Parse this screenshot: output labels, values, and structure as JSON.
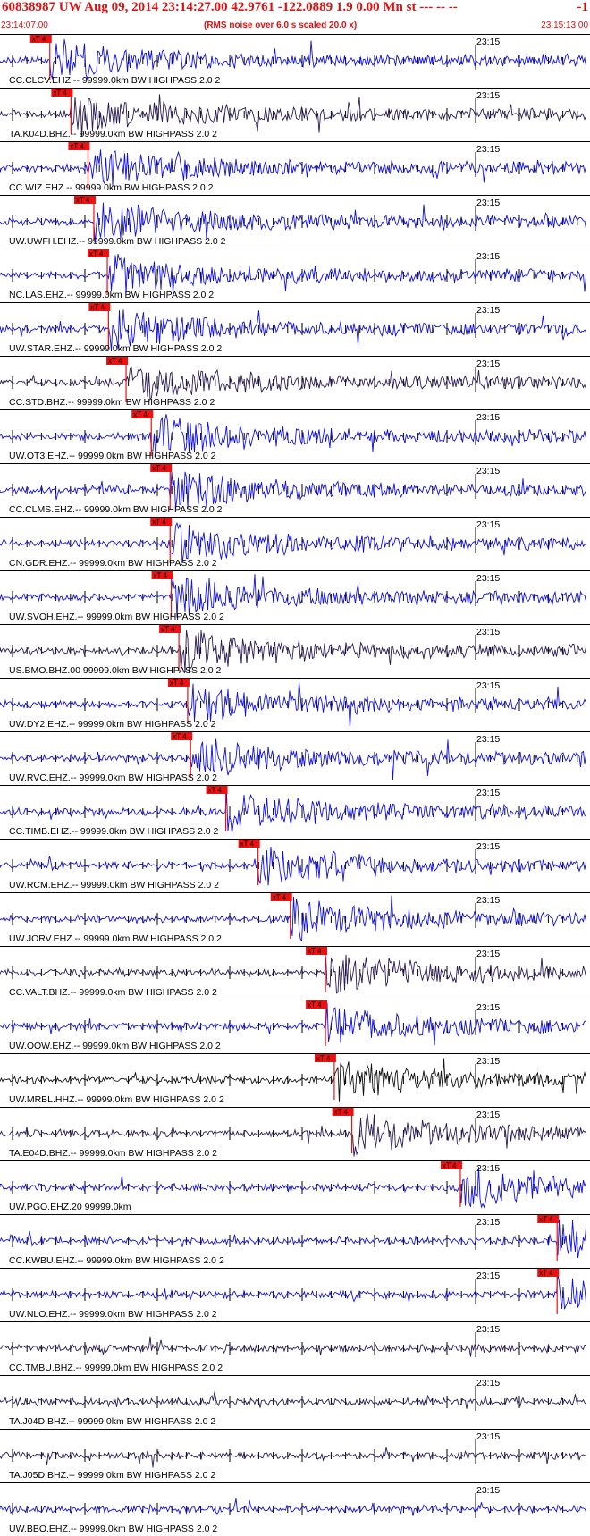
{
  "header": {
    "title": "60838987 UW Aug 09, 2014 23:14:27.00   42.9761 -122.0889  1.9 0.00 Mn st --- -- --",
    "end_mark": "-1",
    "start_time": "23:14:07.00",
    "rms_note": "(RMS noise over 6.0 s scaled 20.0 x)",
    "end_time": "23:15:13.00"
  },
  "tick_label": "23:15",
  "pick_label": "xT 4",
  "colors": {
    "header": "#dd1111",
    "blue": "#1010dd",
    "dark": "#2a1a55",
    "black": "#111111",
    "pick": "#ee1111",
    "grid": "#000000"
  },
  "traces": [
    {
      "label": "CC.CLCV.EHZ.-- 99999.0km BW  HIGHPASS  2.0  2",
      "color": "blue",
      "pick": 0.085
    },
    {
      "label": "TA.K04D.BHZ.-- 99999.0km BW  HIGHPASS  2.0  2",
      "color": "dark",
      "pick": 0.121
    },
    {
      "label": "CC.WIZ.EHZ.-- 99999.0km BW  HIGHPASS  2.0  2",
      "color": "blue",
      "pick": 0.15
    },
    {
      "label": "UW.UWFH.EHZ.-- 99999.0km BW  HIGHPASS  2.0  2",
      "color": "blue",
      "pick": 0.16
    },
    {
      "label": "NC.LAS.EHZ.-- 99999.0km BW  HIGHPASS  2.0  2",
      "color": "blue",
      "pick": 0.183
    },
    {
      "label": "UW.STAR.EHZ.-- 99999.0km BW  HIGHPASS  2.0  2",
      "color": "blue",
      "pick": 0.185
    },
    {
      "label": "CC.STD.BHZ.-- 99999.0km BW  HIGHPASS  2.0  2",
      "color": "dark",
      "pick": 0.215
    },
    {
      "label": "UW.OT3.EHZ.-- 99999.0km BW  HIGHPASS  2.0  2",
      "color": "blue",
      "pick": 0.258
    },
    {
      "label": "CC.CLMS.EHZ.-- 99999.0km BW  HIGHPASS  2.0  2",
      "color": "blue",
      "pick": 0.29
    },
    {
      "label": "CN.GDR.EHZ.-- 99999.0km BW  HIGHPASS  2.0  2",
      "color": "blue",
      "pick": 0.29
    },
    {
      "label": "UW.SVOH.EHZ.-- 99999.0km BW  HIGHPASS  2.0  2",
      "color": "blue",
      "pick": 0.292
    },
    {
      "label": "US.BMO.BHZ.00 99999.0km BW  HIGHPASS  2.0  2",
      "color": "dark",
      "pick": 0.305
    },
    {
      "label": "UW.DY2.EHZ.-- 99999.0km BW  HIGHPASS  2.0  2",
      "color": "blue",
      "pick": 0.32
    },
    {
      "label": "UW.RVC.EHZ.-- 99999.0km BW  HIGHPASS  2.0  2",
      "color": "blue",
      "pick": 0.325
    },
    {
      "label": "CC.TIMB.EHZ.-- 99999.0km BW  HIGHPASS  2.0  2",
      "color": "blue",
      "pick": 0.385
    },
    {
      "label": "UW.RCM.EHZ.-- 99999.0km BW  HIGHPASS  2.0  2",
      "color": "blue",
      "pick": 0.44
    },
    {
      "label": "UW.JORV.EHZ.-- 99999.0km BW  HIGHPASS  2.0  2",
      "color": "blue",
      "pick": 0.495
    },
    {
      "label": "CC.VALT.BHZ.-- 99999.0km BW  HIGHPASS  2.0  2",
      "color": "dark",
      "pick": 0.555
    },
    {
      "label": "UW.OOW.EHZ.-- 99999.0km BW  HIGHPASS  2.0  2",
      "color": "blue",
      "pick": 0.555
    },
    {
      "label": "UW.MRBL.HHZ.-- 99999.0km BW  HIGHPASS  2.0  2",
      "color": "black",
      "pick": 0.57
    },
    {
      "label": "TA.E04D.BHZ.-- 99999.0km BW  HIGHPASS  2.0  2",
      "color": "dark",
      "pick": 0.6
    },
    {
      "label": "UW.PGO.EHZ.20 99999.0km",
      "color": "blue",
      "pick": 0.785
    },
    {
      "label": "CC.KWBU.EHZ.-- 99999.0km BW  HIGHPASS  2.0  2",
      "color": "blue",
      "pick": 0.95
    },
    {
      "label": "UW.NLO.EHZ.-- 99999.0km BW  HIGHPASS  2.0  2",
      "color": "blue",
      "pick": 0.95
    },
    {
      "label": "CC.TMBU.BHZ.-- 99999.0km BW  HIGHPASS  2.0  2",
      "color": "dark",
      "pick": null
    },
    {
      "label": "TA.J04D.BHZ.-- 99999.0km BW  HIGHPASS  2.0  2",
      "color": "dark",
      "pick": null
    },
    {
      "label": "TA.J05D.BHZ.-- 99999.0km BW  HIGHPASS  2.0  2",
      "color": "dark",
      "pick": null
    },
    {
      "label": "UW.BBO.EHZ.-- 99999.0km BW  HIGHPASS  2.0  2",
      "color": "blue",
      "pick": null
    }
  ]
}
